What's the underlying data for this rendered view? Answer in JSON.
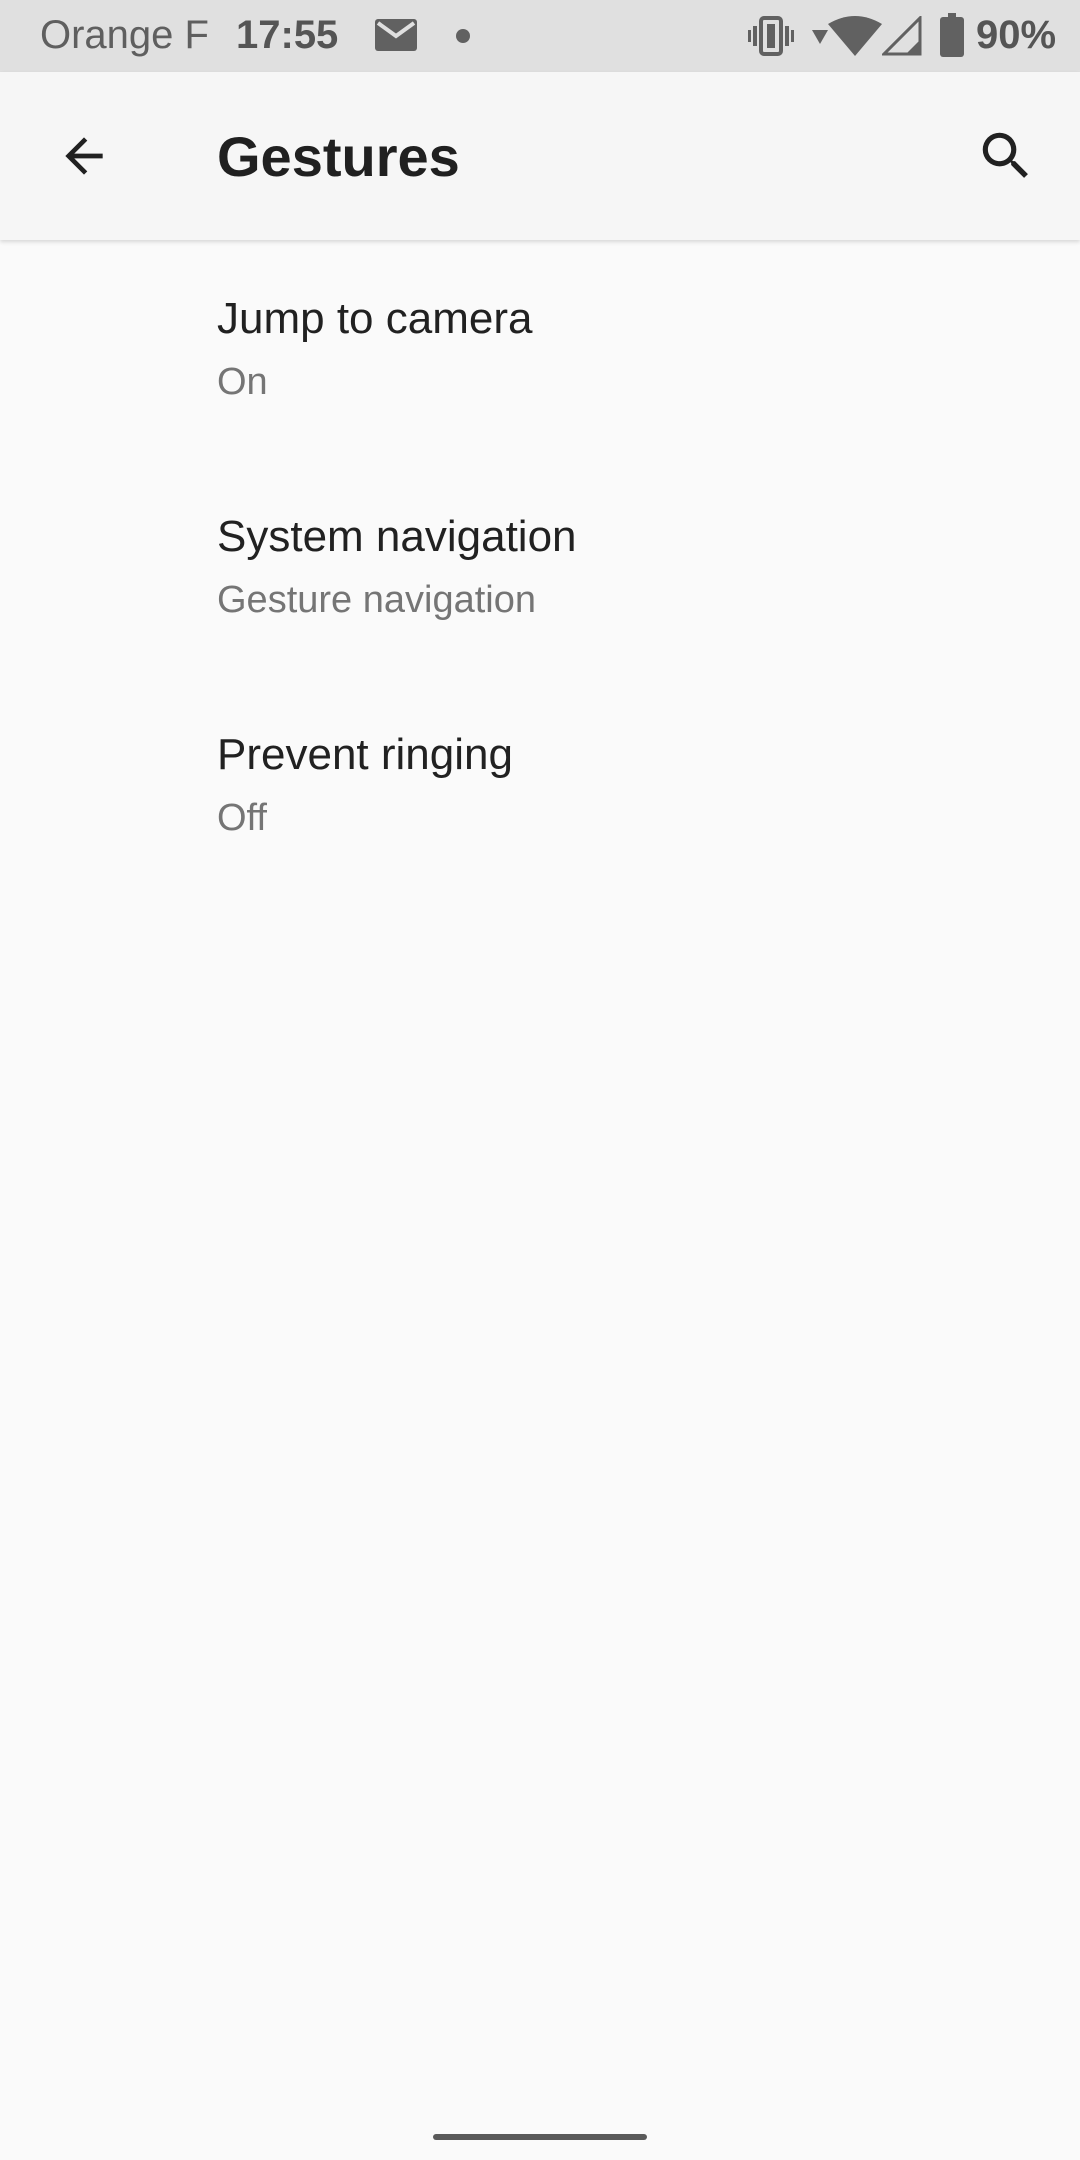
{
  "status_bar": {
    "carrier": "Orange F",
    "time": "17:55",
    "battery": "90%",
    "icons": [
      "mail-icon",
      "dot-icon",
      "vibrate-icon",
      "data-arrow-icon",
      "wifi-icon",
      "signal-icon",
      "battery-icon"
    ]
  },
  "app_bar": {
    "title": "Gestures",
    "back_icon": "arrow-back-icon",
    "search_icon": "search-icon"
  },
  "list": {
    "items": [
      {
        "title": "Jump to camera",
        "summary": "On"
      },
      {
        "title": "System navigation",
        "summary": "Gesture navigation"
      },
      {
        "title": "Prevent ringing",
        "summary": "Off"
      }
    ]
  },
  "colors": {
    "background": "#fafafa",
    "status_bar": "#e0e0e0",
    "app_bar": "#f6f6f6",
    "title_text": "#212121",
    "summary_text": "#757575"
  }
}
